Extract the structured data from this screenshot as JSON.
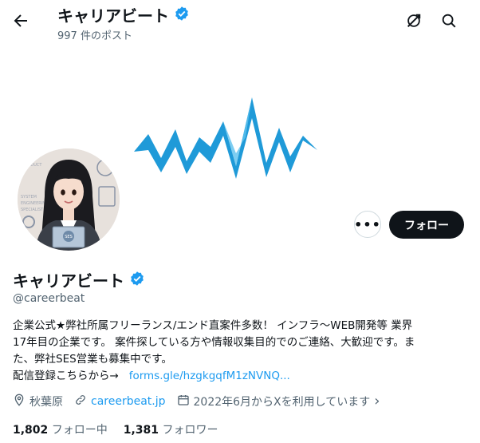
{
  "header": {
    "title": "キャリアビート",
    "post_count": "997 件のポスト"
  },
  "profile": {
    "name": "キャリアビート",
    "handle": "@careerbeat",
    "follow_label": "フォロー",
    "more_label": "•••"
  },
  "bio": {
    "line1": "企業公式★弊社所属フリーランス/エンド直案件多数！ インフラ〜WEB開発等 業界",
    "line2": "17年目の企業です。 案件探している方や情報収集目的でのご連絡、大歓迎です。ま",
    "line3": "た、弊社SES営業も募集中です。",
    "line4_prefix": "配信登録こちらから→",
    "line4_link": "forms.gle/hzgkgqfM1zNVNQ..."
  },
  "meta": {
    "location": "秋葉原",
    "website": "careerbeat.jp",
    "joined": "2022年6月からXを利用しています",
    "joined_chevron": "›"
  },
  "stats": {
    "following_count": "1,802",
    "following_label": "フォロー中",
    "followers_count": "1,381",
    "followers_label": "フォロワー"
  },
  "colors": {
    "verified": "#1d9bf0",
    "link": "#1d9bf0",
    "wave": "#29a3e0",
    "button_bg": "#0f1419"
  },
  "avatar_badge": "SES",
  "avatar_bg_text": [
    "PRODUCT",
    "ENGINEERING",
    "SPECIALIST",
    "SYSTEM"
  ]
}
